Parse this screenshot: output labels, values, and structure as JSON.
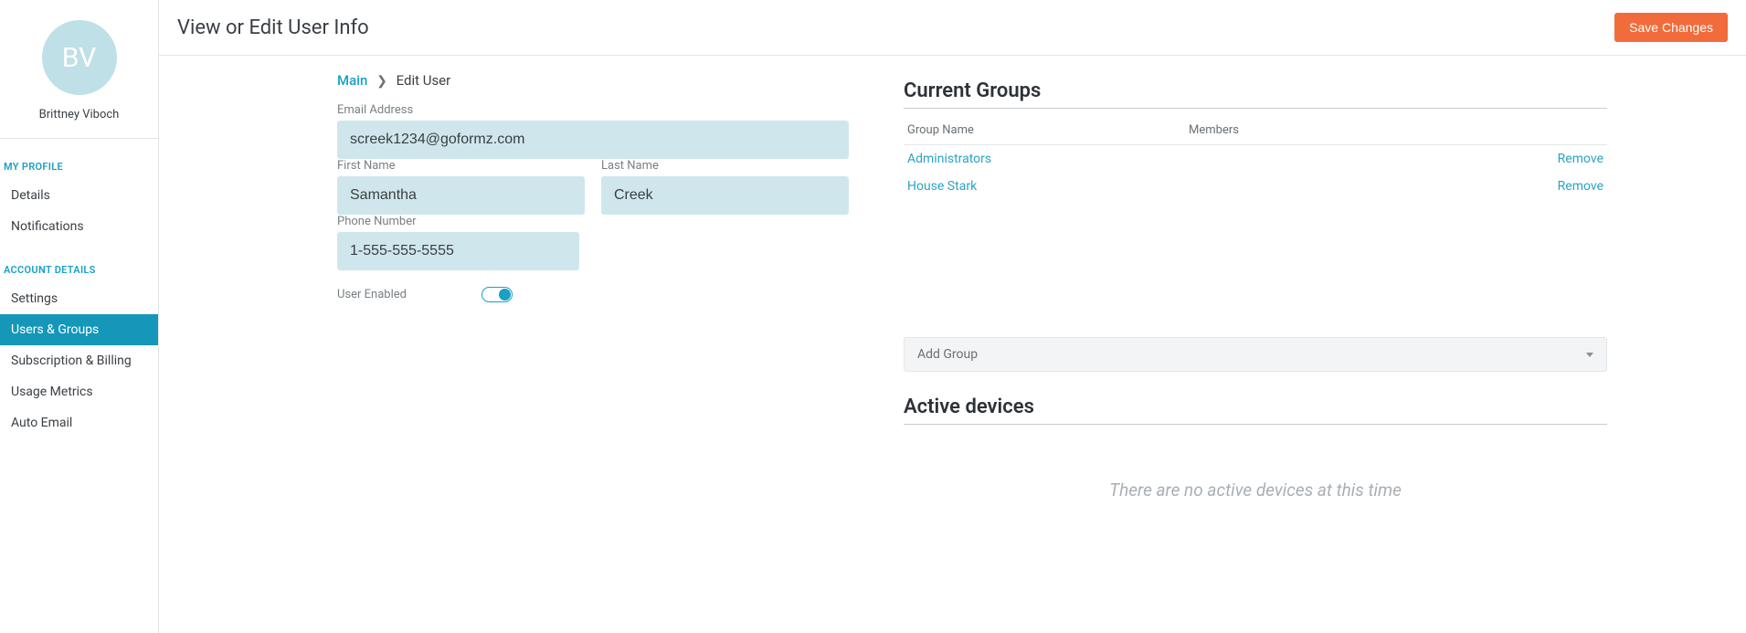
{
  "sidebar": {
    "avatar_initials": "BV",
    "profile_name": "Brittney Viboch",
    "section_profile_title": "MY PROFILE",
    "profile_items": [
      "Details",
      "Notifications"
    ],
    "section_account_title": "ACCOUNT DETAILS",
    "account_items": [
      "Settings",
      "Users & Groups",
      "Subscription & Billing",
      "Usage Metrics",
      "Auto Email"
    ],
    "active_account_item": "Users & Groups"
  },
  "header": {
    "page_title": "View or Edit User Info",
    "save_label": "Save Changes"
  },
  "breadcrumb": {
    "root": "Main",
    "current": "Edit User"
  },
  "form": {
    "email_label": "Email Address",
    "email_value": "screek1234@goformz.com",
    "first_name_label": "First Name",
    "first_name_value": "Samantha",
    "last_name_label": "Last Name",
    "last_name_value": "Creek",
    "phone_label": "Phone Number",
    "phone_value": "1-555-555-5555",
    "user_enabled_label": "User Enabled"
  },
  "groups": {
    "title": "Current Groups",
    "col_group": "Group Name",
    "col_members": "Members",
    "rows": [
      {
        "name": "Administrators",
        "remove": "Remove"
      },
      {
        "name": "House Stark",
        "remove": "Remove"
      }
    ],
    "add_group_label": "Add Group"
  },
  "devices": {
    "title": "Active devices",
    "empty_text": "There are no active devices at this time"
  }
}
